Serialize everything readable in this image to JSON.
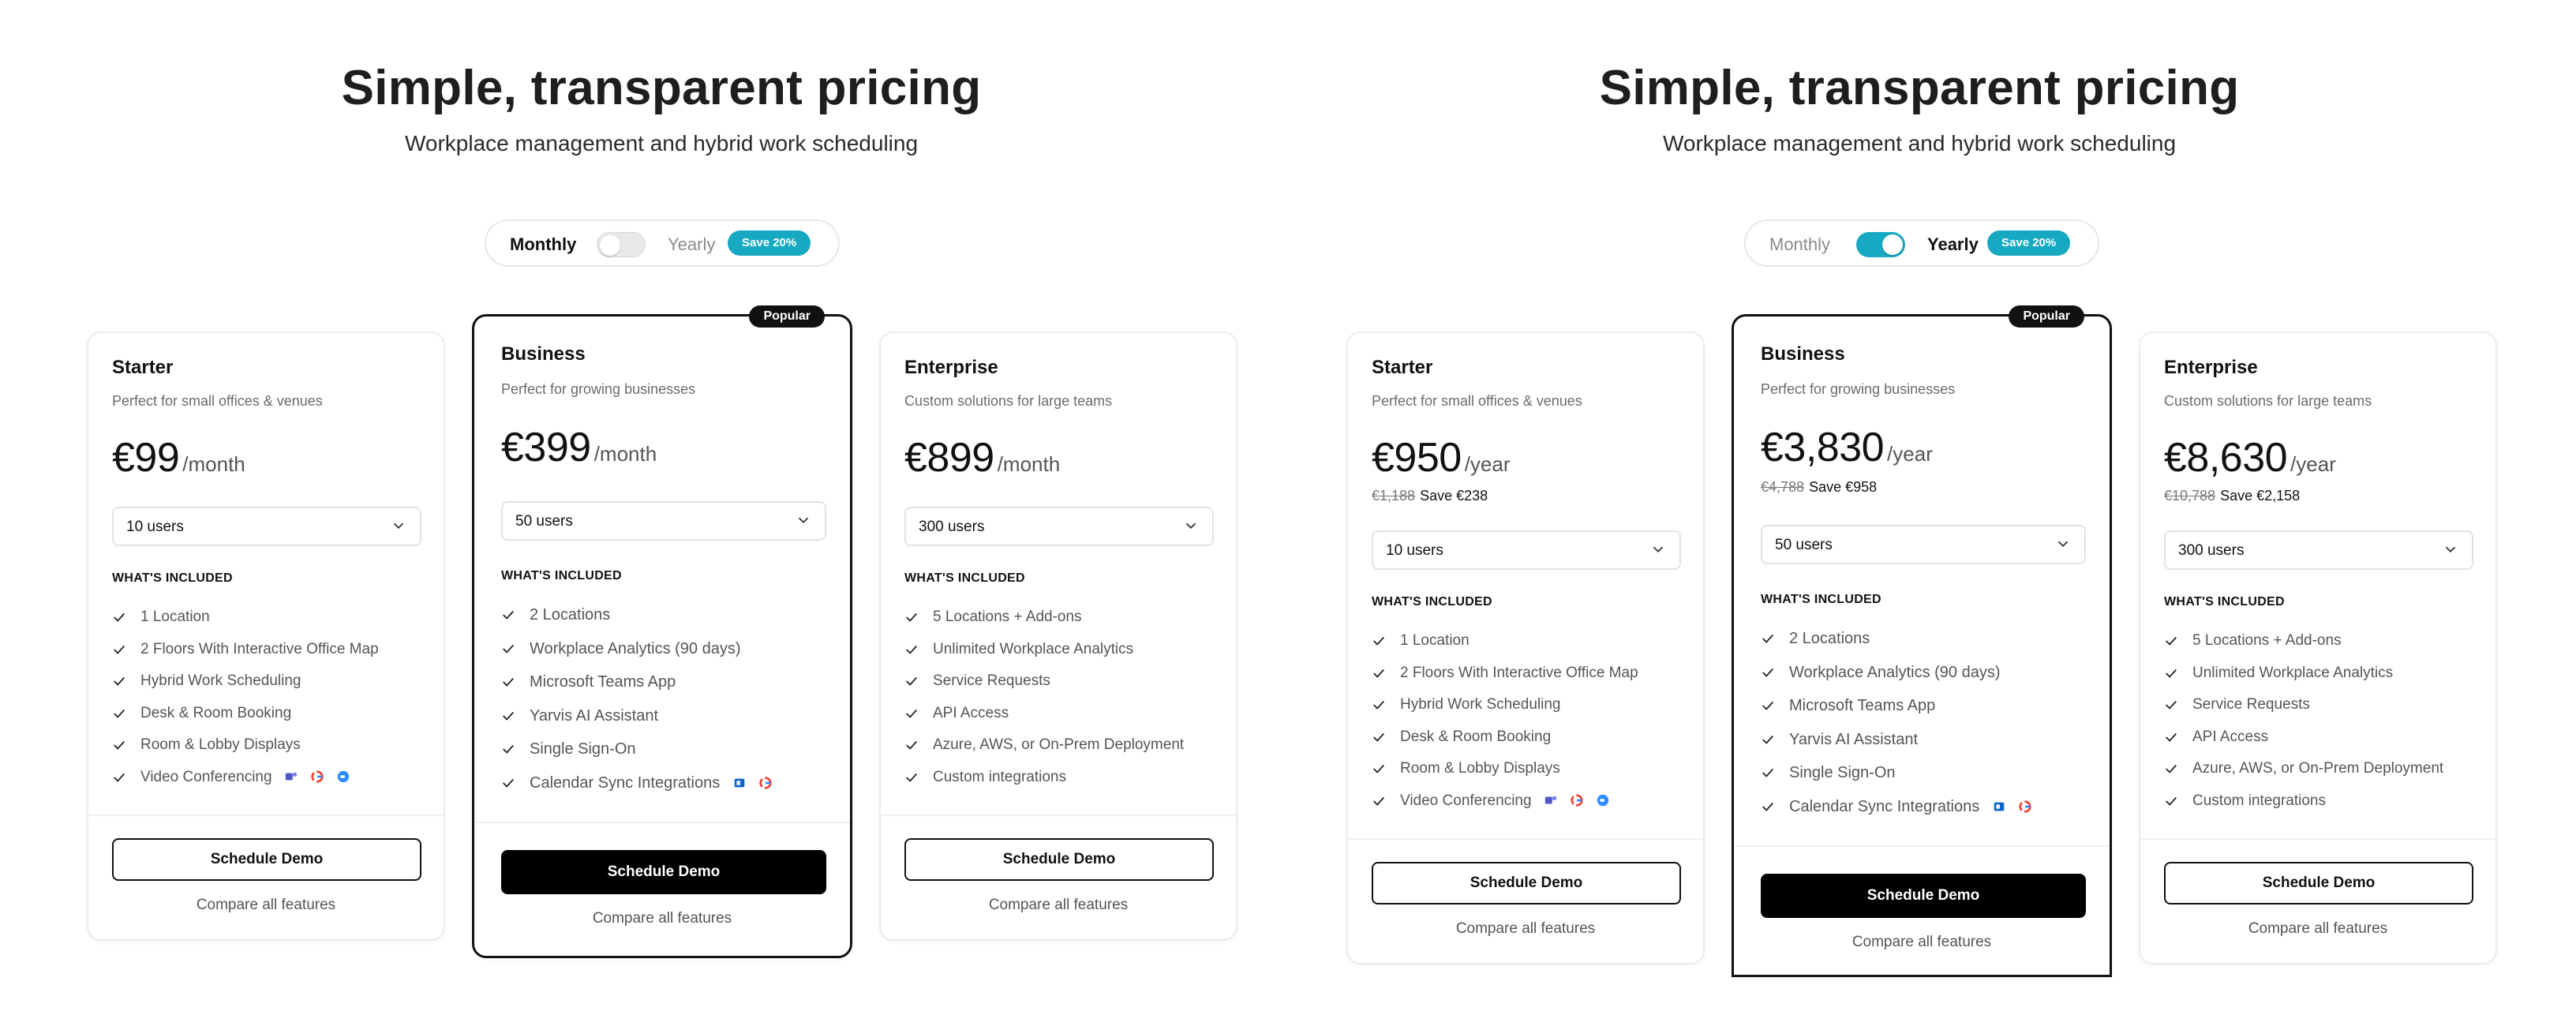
{
  "header": {
    "title": "Simple, transparent pricing",
    "subtitle": "Workplace management and hybrid work scheduling"
  },
  "toggle": {
    "monthly_label": "Monthly",
    "yearly_label": "Yearly",
    "save_badge": "Save 20%"
  },
  "popular_badge": "Popular",
  "included_heading": "WHAT'S INCLUDED",
  "cta_label": "Schedule Demo",
  "compare_label": "Compare all features",
  "colors": {
    "accent": "#17a9c1",
    "dark": "#111111"
  },
  "monthly": {
    "billing_selected": "Monthly",
    "plans": [
      {
        "name": "Starter",
        "description": "Perfect for small offices & venues",
        "price": "€99",
        "period": "/month",
        "users": "10 users",
        "features": [
          "1 Location",
          "2 Floors With Interactive Office Map",
          "Hybrid Work Scheduling",
          "Desk & Room Booking",
          "Room & Lobby Displays",
          "Video Conferencing"
        ]
      },
      {
        "name": "Business",
        "description": "Perfect for growing businesses",
        "price": "€399",
        "period": "/month",
        "users": "50 users",
        "features": [
          "2 Locations",
          "Workplace Analytics (90 days)",
          "Microsoft Teams App",
          "Yarvis AI Assistant",
          "Single Sign-On",
          "Calendar Sync Integrations"
        ]
      },
      {
        "name": "Enterprise",
        "description": "Custom solutions for large teams",
        "price": "€899",
        "period": "/month",
        "users": "300 users",
        "features": [
          "5 Locations + Add-ons",
          "Unlimited Workplace Analytics",
          "Service Requests",
          "API Access",
          "Azure, AWS, or On-Prem Deployment",
          "Custom integrations"
        ]
      }
    ]
  },
  "yearly": {
    "billing_selected": "Yearly",
    "plans": [
      {
        "name": "Starter",
        "description": "Perfect for small offices & venues",
        "price": "€950",
        "period": "/year",
        "original_price": "€1,188",
        "savings": "Save €238",
        "users": "10 users",
        "features": [
          "1 Location",
          "2 Floors With Interactive Office Map",
          "Hybrid Work Scheduling",
          "Desk & Room Booking",
          "Room & Lobby Displays",
          "Video Conferencing"
        ]
      },
      {
        "name": "Business",
        "description": "Perfect for growing businesses",
        "price": "€3,830",
        "period": "/year",
        "original_price": "€4,788",
        "savings": "Save €958",
        "users": "50 users",
        "features": [
          "2 Locations",
          "Workplace Analytics (90 days)",
          "Microsoft Teams App",
          "Yarvis AI Assistant",
          "Single Sign-On",
          "Calendar Sync Integrations"
        ]
      },
      {
        "name": "Enterprise",
        "description": "Custom solutions for large teams",
        "price": "€8,630",
        "period": "/year",
        "original_price": "€10,788",
        "savings": "Save €2,158",
        "users": "300 users",
        "features": [
          "5 Locations + Add-ons",
          "Unlimited Workplace Analytics",
          "Service Requests",
          "API Access",
          "Azure, AWS, or On-Prem Deployment",
          "Custom integrations"
        ]
      }
    ]
  }
}
